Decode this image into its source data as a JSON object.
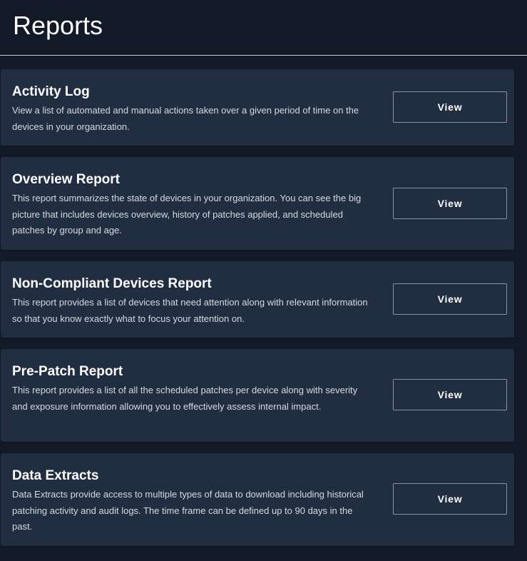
{
  "page": {
    "title": "Reports"
  },
  "reports": [
    {
      "title": "Activity Log",
      "description": "View a list of automated and manual actions taken over a given period of time on the devices in your organization.",
      "button_label": "View"
    },
    {
      "title": "Overview Report",
      "description": "This report summarizes the state of devices in your organization. You can see the big picture that includes devices overview, history of patches applied, and scheduled patches by group and age.",
      "button_label": "View"
    },
    {
      "title": "Non-Compliant Devices Report",
      "description": "This report provides a list of devices that need attention along with relevant information so that you know exactly what to focus your attention on.",
      "button_label": "View"
    },
    {
      "title": "Pre-Patch Report",
      "description": "This report provides a list of all the scheduled patches per device along with severity and exposure information allowing you to effectively assess internal impact.",
      "button_label": "View"
    },
    {
      "title": "Data Extracts",
      "description": "Data Extracts provide access to multiple types of data to download including historical patching activity and audit logs. The time frame can be defined up to 90 days in the past.",
      "button_label": "View"
    }
  ],
  "colors": {
    "page_background": "#131a27",
    "card_background": "#212d41",
    "button_border": "#8a94a3",
    "text_primary": "#ffffff",
    "text_secondary": "#d5dae2"
  }
}
